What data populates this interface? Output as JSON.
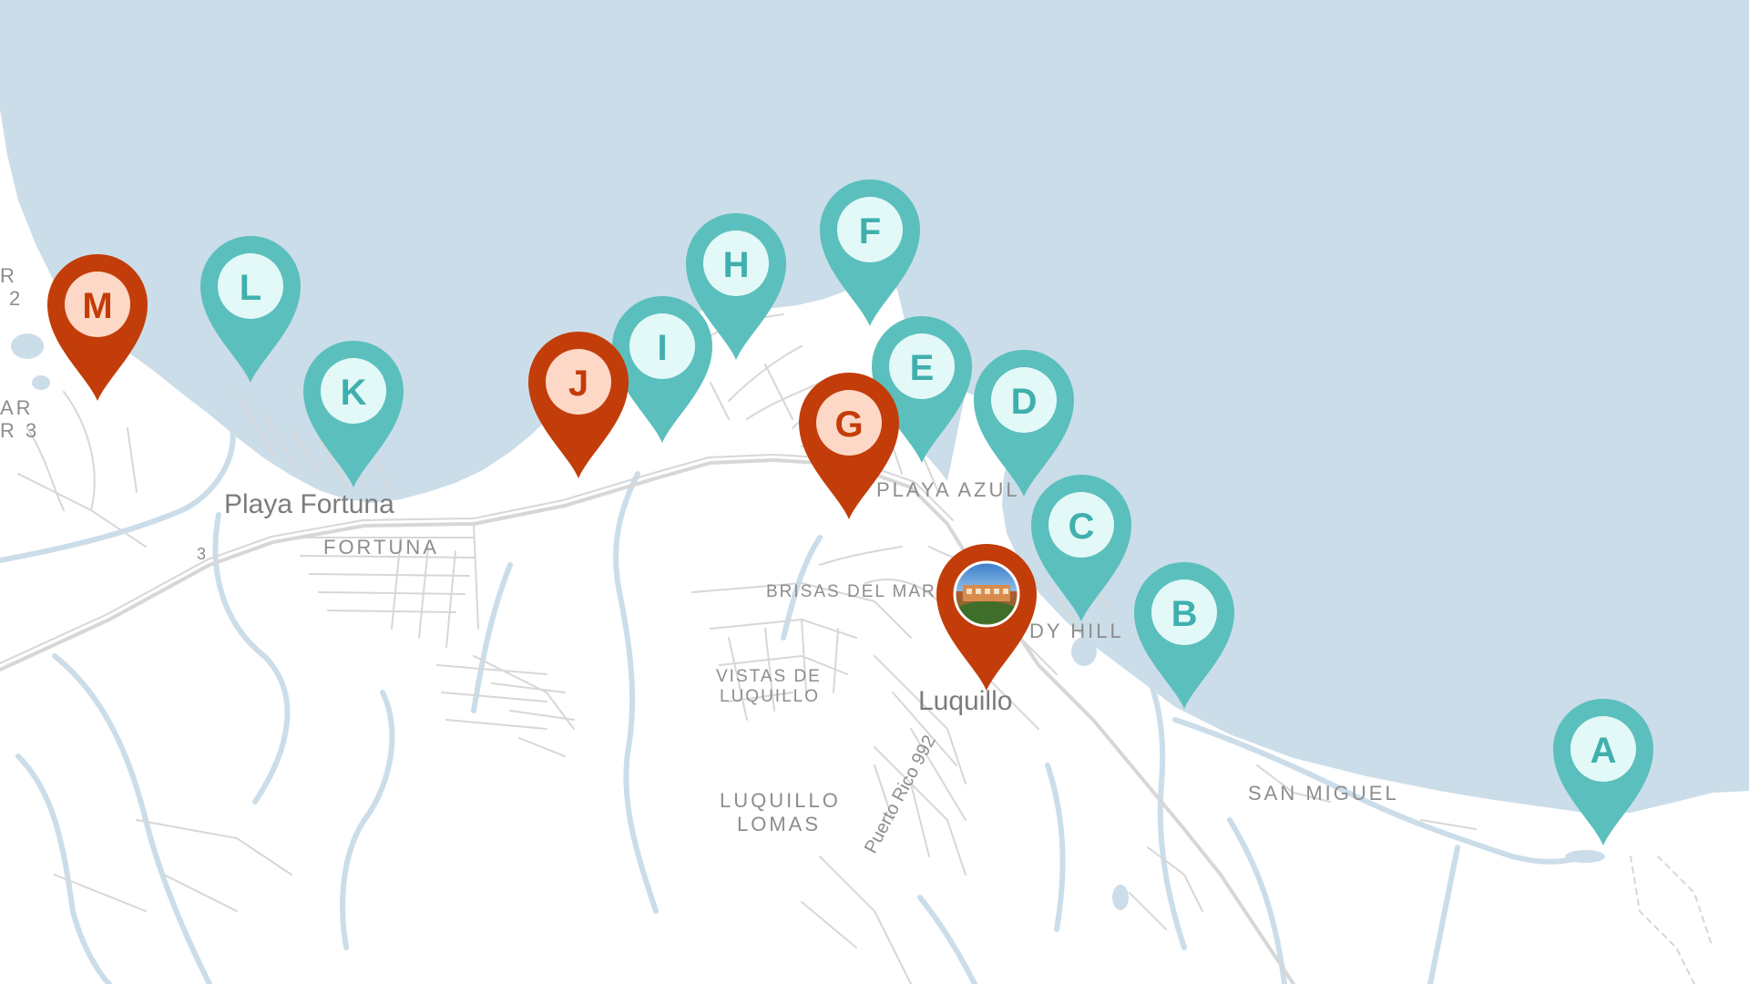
{
  "map": {
    "colors": {
      "water": "#cbdde9",
      "land": "#ffffff",
      "road": "#d7d7d7",
      "stream": "#cbdde9",
      "teal_pin": "#5bbfbd",
      "teal_inner": "#e3f9f8",
      "teal_text": "#3fb0ad",
      "orange_pin": "#c23d09",
      "orange_inner": "#fdd8c6",
      "orange_text": "#c23d09"
    },
    "labels": {
      "playa_fortuna": "Playa Fortuna",
      "fortuna": "FORTUNA",
      "playa_azul": "PLAYA AZUL",
      "brisas_del_mar": "BRISAS DEL MAR",
      "sandy_hill": "DY HILL",
      "vistas_line1": "VISTAS DE",
      "vistas_line2": "LUQUILLO",
      "luquillo": "Luquillo",
      "luquillo_lomas_line1": "LUQUILLO",
      "luquillo_lomas_line2": "LOMAS",
      "san_miguel": "SAN MIGUEL",
      "road_992": "Puerto Rico 992",
      "road_3": "3",
      "edge_1": "R",
      "edge_2": "2",
      "edge_3": "AR",
      "edge_4": "R 3"
    },
    "markers": [
      {
        "letter": "A",
        "style": "teal"
      },
      {
        "letter": "B",
        "style": "teal"
      },
      {
        "letter": "C",
        "style": "teal"
      },
      {
        "letter": "D",
        "style": "teal"
      },
      {
        "letter": "E",
        "style": "teal"
      },
      {
        "letter": "F",
        "style": "teal"
      },
      {
        "letter": "G",
        "style": "orange"
      },
      {
        "letter": "H",
        "style": "teal"
      },
      {
        "letter": "I",
        "style": "teal"
      },
      {
        "letter": "J",
        "style": "orange"
      },
      {
        "letter": "K",
        "style": "teal"
      },
      {
        "letter": "L",
        "style": "teal"
      },
      {
        "letter": "M",
        "style": "orange"
      }
    ],
    "photo_marker": {
      "style": "orange",
      "icon": "hotel-photo-icon"
    }
  }
}
